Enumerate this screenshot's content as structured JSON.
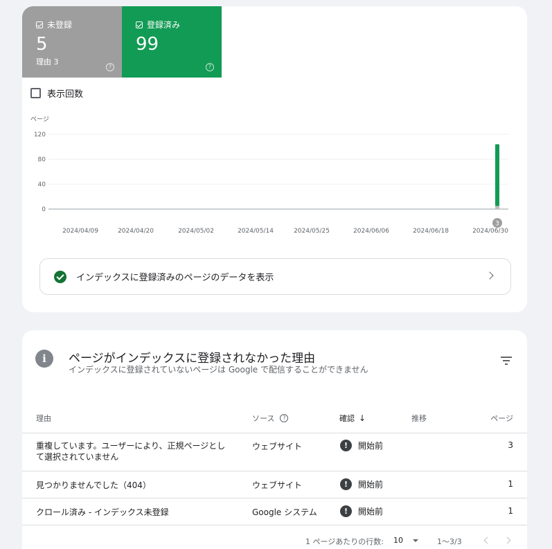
{
  "summary": {
    "not_indexed": {
      "label": "未登録",
      "count": "5",
      "sub": "理由 3",
      "color": "#9e9e9e"
    },
    "indexed": {
      "label": "登録済み",
      "count": "99",
      "color": "#129b54"
    },
    "help_glyph": "?"
  },
  "impressions_label": "表示回数",
  "chart_data": {
    "type": "bar",
    "ylabel": "ページ",
    "yticks": [
      "120",
      "80",
      "40",
      "0"
    ],
    "ylim": [
      0,
      120
    ],
    "xticks": [
      "2024/04/09",
      "2024/04/20",
      "2024/05/02",
      "2024/05/14",
      "2024/05/25",
      "2024/06/06",
      "2024/06/18",
      "2024/06/30"
    ],
    "series": [
      {
        "name": "登録済み",
        "color": "#129b54",
        "values": [
          99
        ]
      },
      {
        "name": "未登録",
        "color": "#bdbdbd",
        "values": [
          5
        ]
      }
    ],
    "annotation": "3",
    "grid": true
  },
  "view_indexed_link": "インデックスに登録済みのページのデータを表示",
  "reasons_card": {
    "title": "ページがインデックスに登録されなかった理由",
    "subtitle": "インデックスに登録されていないページは Google で配信することができません",
    "columns": {
      "reason": "理由",
      "source": "ソース",
      "validation": "確認",
      "trend": "推移",
      "pages": "ページ"
    },
    "rows": [
      {
        "reason": "重複しています。ユーザーにより、正規ページとして選択されていません",
        "source": "ウェブサイト",
        "validation": "開始前",
        "pages": "3"
      },
      {
        "reason": "見つかりませんでした（404）",
        "source": "ウェブサイト",
        "validation": "開始前",
        "pages": "1"
      },
      {
        "reason": "クロール済み - インデックス未登録",
        "source": "Google システム",
        "validation": "開始前",
        "pages": "1"
      }
    ],
    "warn_glyph": "!",
    "pager": {
      "rows_label": "1 ページあたりの行数:",
      "rows_value": "10",
      "range": "1〜3/3"
    }
  }
}
